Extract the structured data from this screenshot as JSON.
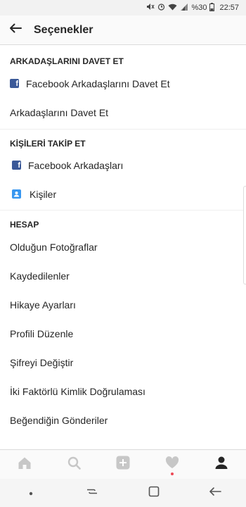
{
  "status_bar": {
    "battery_text": "%30",
    "time": "22:57"
  },
  "header": {
    "title": "Seçenekler"
  },
  "sections": [
    {
      "title": "ARKADAŞLARINI DAVET ET",
      "items": [
        {
          "label": "Facebook Arkadaşlarını Davet Et",
          "icon": "facebook-icon"
        },
        {
          "label": "Arkadaşlarını Davet Et"
        }
      ]
    },
    {
      "title": "KİŞİLERİ TAKİP ET",
      "items": [
        {
          "label": "Facebook Arkadaşları",
          "icon": "facebook-icon"
        },
        {
          "label": "Kişiler",
          "icon": "contacts-icon"
        }
      ]
    },
    {
      "title": "HESAP",
      "items": [
        {
          "label": "Olduğun Fotoğraflar"
        },
        {
          "label": "Kaydedilenler"
        },
        {
          "label": "Hikaye Ayarları"
        },
        {
          "label": "Profili Düzenle"
        },
        {
          "label": "Şifreyi Değiştir"
        },
        {
          "label": "İki Faktörlü Kimlik Doğrulaması"
        },
        {
          "label": "Beğendiğin Gönderiler"
        }
      ]
    }
  ],
  "tab_bar": {
    "tabs": [
      "home-icon",
      "search-icon",
      "add-post-icon",
      "activity-heart-icon",
      "profile-icon"
    ],
    "active_tab": "profile-icon"
  },
  "colors": {
    "facebook": "#3b5998",
    "contacts": "#3897f0",
    "notification_dot": "#ed4956"
  }
}
